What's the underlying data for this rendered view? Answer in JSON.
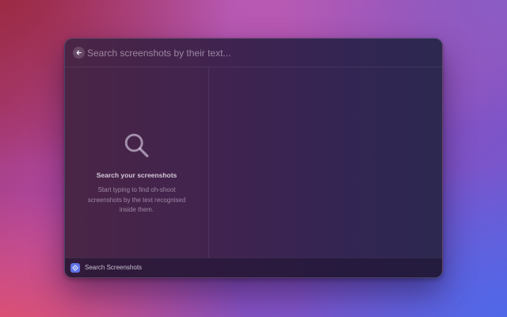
{
  "search": {
    "placeholder": "Search screenshots by their text...",
    "value": "",
    "back_icon": "arrow-left-icon"
  },
  "empty_state": {
    "icon": "magnifying-glass-icon",
    "title": "Search your screenshots",
    "text": "Start typing to find oh-shoot screenshots by the text recognised inside them."
  },
  "footer": {
    "icon": "gear-icon",
    "icon_color": "#5f72e6",
    "label": "Search Screenshots"
  }
}
